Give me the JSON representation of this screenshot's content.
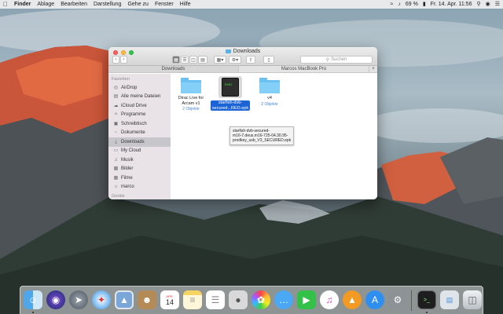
{
  "menubar": {
    "app": "Finder",
    "items": [
      "Ablage",
      "Bearbeiten",
      "Darstellung",
      "Gehe zu",
      "Fenster",
      "Hilfe"
    ],
    "battery": "69 %",
    "datetime": "Fr. 14. Apr.  11:56"
  },
  "window": {
    "title": "Downloads",
    "search_placeholder": "Suchen",
    "path_tabs": [
      "Downloads",
      "Marcos MacBook Pro"
    ],
    "sidebar": {
      "section": "Favoriten",
      "section2": "Geräte",
      "items": [
        {
          "label": "AirDrop",
          "icon": "airdrop-icon"
        },
        {
          "label": "Alle meine Dateien",
          "icon": "all-files-icon"
        },
        {
          "label": "iCloud Drive",
          "icon": "cloud-icon"
        },
        {
          "label": "Programme",
          "icon": "applications-icon"
        },
        {
          "label": "Schreibtisch",
          "icon": "desktop-icon"
        },
        {
          "label": "Dokumente",
          "icon": "documents-icon"
        },
        {
          "label": "Downloads",
          "icon": "downloads-icon",
          "selected": true
        },
        {
          "label": "My Cloud",
          "icon": "folder-icon"
        },
        {
          "label": "Musik",
          "icon": "music-icon"
        },
        {
          "label": "Bilder",
          "icon": "pictures-icon"
        },
        {
          "label": "Filme",
          "icon": "movies-icon"
        },
        {
          "label": "marco",
          "icon": "home-icon"
        }
      ]
    },
    "files": [
      {
        "name_line1": "Dirac Live for",
        "name_line2": "Arcam v1",
        "subtitle": "2 Objekte"
      },
      {
        "name_line1": "starfish-dvb-",
        "name_line2": "secured...RED.epk",
        "selected": true
      },
      {
        "name_line1": "v4",
        "subtitle": "2 Objekte"
      }
    ],
    "tooltip": {
      "line1": "starfish-dvb-secured-",
      "line2": "m16-7.deus.m16-725-04.30.95-",
      "line3": "prodkey_usb_V3_SECURED.epk"
    }
  },
  "dock": {
    "icons": [
      "finder-icon",
      "siri-icon",
      "launchpad-icon",
      "safari-icon",
      "preview-icon",
      "contacts-icon",
      "calendar-icon",
      "notes-icon",
      "reminders-icon",
      "photo-booth-icon",
      "photos-icon",
      "messages-icon",
      "facetime-icon",
      "itunes-icon",
      "ibooks-icon",
      "app-store-icon",
      "system-preferences-icon",
      "terminal-icon",
      "finder-window-icon",
      "trash-icon"
    ],
    "calendar_day": "14",
    "calendar_month": "APR."
  }
}
